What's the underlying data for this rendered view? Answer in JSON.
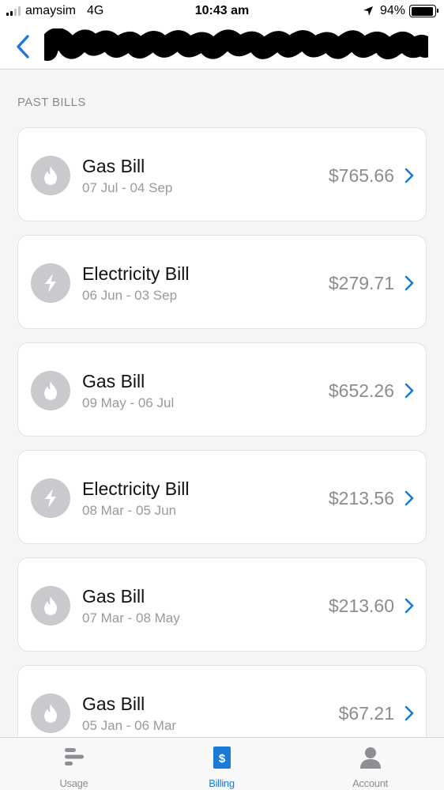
{
  "status_bar": {
    "carrier": "amaysim",
    "network": "4G",
    "time": "10:43 am",
    "battery": "94%",
    "battery_level": 0.94
  },
  "nav": {
    "back_icon": "chevron-left-icon",
    "accent": "#1a7ad8"
  },
  "section_header": "PAST BILLS",
  "bills": [
    {
      "title": "Gas Bill",
      "dates": "07 Jul - 04 Sep",
      "amount": "$765.66",
      "icon": "flame-icon"
    },
    {
      "title": "Electricity Bill",
      "dates": "06 Jun - 03 Sep",
      "amount": "$279.71",
      "icon": "lightning-icon"
    },
    {
      "title": "Gas Bill",
      "dates": "09 May - 06 Jul",
      "amount": "$652.26",
      "icon": "flame-icon"
    },
    {
      "title": "Electricity Bill",
      "dates": "08 Mar - 05 Jun",
      "amount": "$213.56",
      "icon": "lightning-icon"
    },
    {
      "title": "Gas Bill",
      "dates": "07 Mar - 08 May",
      "amount": "$213.60",
      "icon": "flame-icon"
    },
    {
      "title": "Gas Bill",
      "dates": "05 Jan - 06 Mar",
      "amount": "$67.21",
      "icon": "flame-icon"
    }
  ],
  "tabs": [
    {
      "label": "Usage",
      "icon": "usage-icon",
      "active": false
    },
    {
      "label": "Billing",
      "icon": "billing-icon",
      "active": true
    },
    {
      "label": "Account",
      "icon": "account-icon",
      "active": false
    }
  ]
}
